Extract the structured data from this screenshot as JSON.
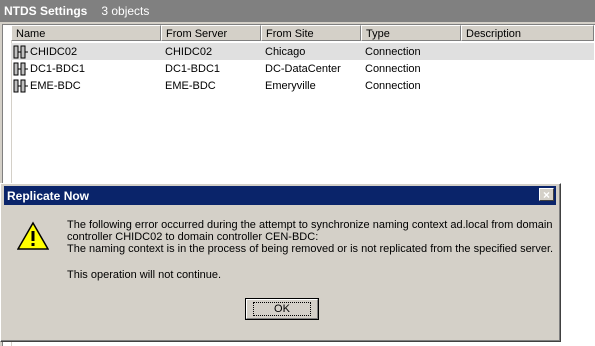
{
  "header": {
    "title": "NTDS Settings",
    "count": "3 objects"
  },
  "columns": [
    "Name",
    "From Server",
    "From Site",
    "Type",
    "Description"
  ],
  "rows": [
    {
      "name": "CHIDC02",
      "from_server": "CHIDC02",
      "from_site": "Chicago",
      "type": "Connection",
      "description": ""
    },
    {
      "name": "DC1-BDC1",
      "from_server": "DC1-BDC1",
      "from_site": "DC-DataCenter",
      "type": "Connection",
      "description": ""
    },
    {
      "name": "EME-BDC",
      "from_server": "EME-BDC",
      "from_site": "Emeryville",
      "type": "Connection",
      "description": ""
    }
  ],
  "dialog": {
    "title": "Replicate Now",
    "close_symbol": "×",
    "lines": [
      "The following error occurred during the attempt to synchronize naming context ad.local from domain",
      "controller CHIDC02 to domain controller CEN-BDC:",
      "The naming context is in the process of being removed or is not replicated from the specified server.",
      "This operation will not continue."
    ],
    "ok_label": "OK",
    "icon": "warning-icon"
  },
  "colors": {
    "header_bg": "#808080",
    "titlebar_bg": "#0a246a",
    "face": "#d4d0c8"
  }
}
